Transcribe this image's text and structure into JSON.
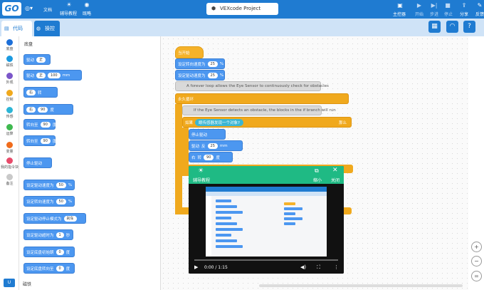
{
  "topbar": {
    "logo": "GO",
    "file_label": "文档",
    "tutorial_label": "辅导教程",
    "find_label": "既略",
    "project_name": "VEXcode Project",
    "brain_label": "主控器",
    "start_label": "开始",
    "step_label": "步进",
    "stop_label": "停止",
    "share_label": "分享",
    "feedback_label": "反馈"
  },
  "tabs": {
    "code": "代码",
    "drive": "操控"
  },
  "categories": [
    {
      "label": "底盘",
      "color": "#1d6fd8"
    },
    {
      "label": "磁铁",
      "color": "#1b9ae0"
    },
    {
      "label": "外观",
      "color": "#7b56c9"
    },
    {
      "label": "控制",
      "color": "#f0a91d"
    },
    {
      "label": "传感",
      "color": "#2cb5d6"
    },
    {
      "label": "运算",
      "color": "#3fb94f"
    },
    {
      "label": "变量",
      "color": "#f06c1c"
    },
    {
      "label": "我的指令块",
      "color": "#e84b6a"
    },
    {
      "label": "备注",
      "color": "#c9c9c9"
    }
  ],
  "palette": {
    "header": "底盘",
    "footer": "磁铁",
    "blocks": [
      {
        "text": "驱动",
        "p1": "正",
        "p2": "",
        "p3": "",
        "unit": ""
      },
      {
        "text": "驱动",
        "p1": "正",
        "p2": "100",
        "p3": "mm",
        "unit": ""
      },
      {
        "text": "",
        "p1": "右",
        "p2": "",
        "p3": "",
        "unit": "转"
      },
      {
        "text": "",
        "p1": "右",
        "p2": "90",
        "p3": "",
        "unit": "度"
      },
      {
        "text": "转向至",
        "p1": "90",
        "p2": "",
        "p3": "",
        "unit": "度"
      },
      {
        "text": "转向至",
        "p1": "90",
        "p2": "",
        "p3": "",
        "unit": "度"
      },
      {
        "text": "停止驱动",
        "p1": "",
        "p2": "",
        "p3": "",
        "unit": ""
      },
      {
        "text": "设定驱动速度为",
        "p1": "50",
        "p2": "",
        "p3": "",
        "unit": "%"
      },
      {
        "text": "设定转向速度为",
        "p1": "50",
        "p2": "",
        "p3": "",
        "unit": "%"
      },
      {
        "text": "设定驱动停止模式为",
        "p1": "刹车",
        "p2": "",
        "p3": "",
        "unit": ""
      },
      {
        "text": "设定驱动超时为",
        "p1": "1",
        "p2": "",
        "p3": "",
        "unit": "秒"
      },
      {
        "text": "设定底盘初始朝",
        "p1": "0",
        "p2": "",
        "p3": "",
        "unit": "度"
      },
      {
        "text": "设定底盘转向至",
        "p1": "0",
        "p2": "",
        "p3": "",
        "unit": "度"
      }
    ]
  },
  "workspace": {
    "when_started": "当开始",
    "set_turn_velocity": "设定转向速度为",
    "set_drive_velocity": "设定驱动速度为",
    "turn_velocity_value": "25",
    "drive_velocity_value": "25",
    "percent": "%",
    "comment1": "A forever loop allows the Eye Sensor to continuously check for obstacles",
    "forever": "永久循环",
    "comment2": "If the Eye Sensor detects an obstacle, the blocks in the if branch will run",
    "if_label": "如果",
    "condition": "眼传感器发现一个对象?",
    "then_label": "那么",
    "stop_drive": "停止驱动",
    "drive_label": "驱动",
    "reverse": "反",
    "drive_dist": "25",
    "mm": "mm",
    "turn_dir": "右",
    "turn_label": "转",
    "turn_deg": "90",
    "deg": "度"
  },
  "modal": {
    "title": "辅导教程",
    "minimize": "缩小",
    "close": "关闭",
    "time": "0:00 / 1:15",
    "progress": 0
  },
  "rightbar": {
    "zoom_in": "+",
    "zoom_out": "−",
    "reset": "="
  }
}
